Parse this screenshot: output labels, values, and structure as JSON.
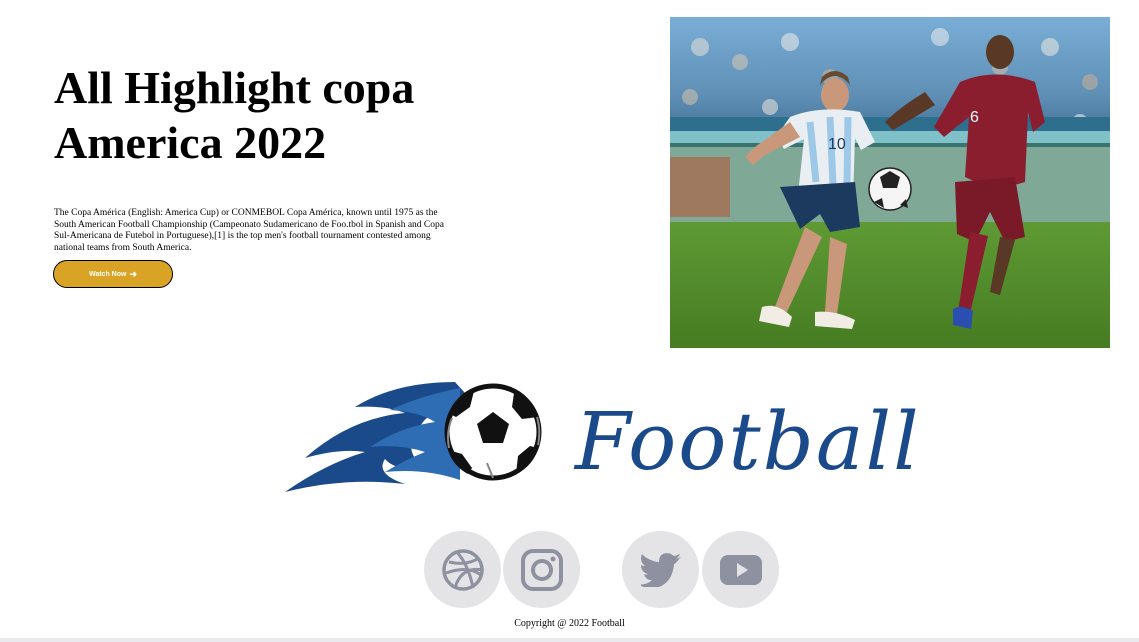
{
  "hero": {
    "title": "All Highlight copa America 2022",
    "description": "The Copa América (English: America Cup) or CONMEBOL Copa América, known until 1975 as the South American Football Championship (Campeonato Sudamericano de Foo.tbol in Spanish and Copa Sul-Americana de Futebol in Portuguese),[1] is the top men's football tournament contested among national teams from South America.",
    "button_label": "Watch Now",
    "button_icon": "arrow-right-icon",
    "button_color": "#d9a426",
    "photo_jersey_left": "10",
    "photo_jersey_right": "6"
  },
  "logo": {
    "text": "Football",
    "color": "#1a4a8a"
  },
  "social": [
    {
      "name": "dribbble",
      "icon": "dribbble-icon"
    },
    {
      "name": "instagram",
      "icon": "instagram-icon"
    },
    {
      "name": "twitter",
      "icon": "twitter-icon"
    },
    {
      "name": "youtube",
      "icon": "youtube-icon"
    }
  ],
  "footer": {
    "copyright": "Copyright @ 2022 Football"
  }
}
